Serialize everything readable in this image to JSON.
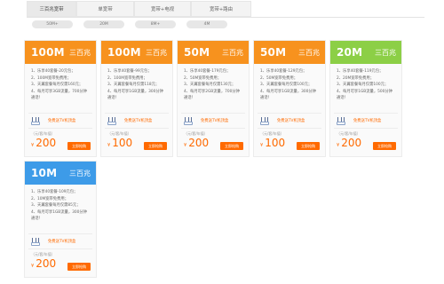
{
  "tabs": [
    "三百兆宽带",
    "单宽带",
    "宽带+电视",
    "宽带+路由"
  ],
  "filters": [
    "50M+",
    "20M",
    "8M+",
    "4M"
  ],
  "colors": {
    "orange": "#f7921e",
    "green": "#8ccf46",
    "blue": "#3d9be8",
    "price": "#ff6a00"
  },
  "cards": [
    {
      "speed": "100M",
      "name": "三百兆",
      "color": "#f7921e",
      "features": [
        "1、乐享40套餐-20元包；",
        "2、100M宽带免费用；",
        "3、天翼套餐每月仅需160元；",
        "4、每月可享3GB流量，700分钟通话！"
      ],
      "gift": "免费送TV机顶盒",
      "unit": "（元/套/年值）",
      "price": "200",
      "currency": "¥",
      "buy": "立即抢购"
    },
    {
      "speed": "100M",
      "name": "三百兆",
      "color": "#f7921e",
      "features": [
        "1、乐享40套餐-99元包；",
        "2、100M宽带免费用；",
        "3、天翼套餐每月仅需118元；",
        "4、每月可享1GB流量，300分钟通话！"
      ],
      "gift": "免费送TV机顶盒",
      "unit": "（元/套/年值）",
      "price": "100",
      "currency": "¥",
      "buy": "立即抢购"
    },
    {
      "speed": "50M",
      "name": "三百兆",
      "color": "#f7921e",
      "features": [
        "1、乐享40套餐-179元包；",
        "2、50M宽带免费用；",
        "3、天翼套餐每月仅需130元；",
        "4、每月可享2GB流量，700分钟通话！"
      ],
      "gift": "免费送TV机顶盒",
      "unit": "（元/套/年值）",
      "price": "200",
      "currency": "¥",
      "buy": "立即抢购"
    },
    {
      "speed": "50M",
      "name": "三百兆",
      "color": "#f7921e",
      "features": [
        "1、乐享40套餐-129元包；",
        "2、50M宽带免费用；",
        "3、天翼套餐每月仅需100元；",
        "4、每月可享1GB流量，300分钟通话！"
      ],
      "gift": "免费送TV机顶盒",
      "unit": "（元/套/年值）",
      "price": "100",
      "currency": "¥",
      "buy": "立即抢购"
    },
    {
      "speed": "20M",
      "name": "三百兆",
      "color": "#8ccf46",
      "features": [
        "1、乐享40套餐-119元包；",
        "2、20M宽带免费用；",
        "3、天翼套餐每月仅需100元；",
        "4、每月可享1GB流量，500分钟通话！"
      ],
      "gift": "免费送TV机顶盒",
      "unit": "（元/套/年值）",
      "price": "200",
      "currency": "¥",
      "buy": "立即抢购"
    },
    {
      "speed": "10M",
      "name": "三百兆",
      "color": "#3d9be8",
      "features": [
        "1、乐享40套餐-109元包；",
        "2、10M宽带免费用；",
        "3、天翼套餐每月仅需85元；",
        "4、每月可享1GB流量，300分钟通话！"
      ],
      "gift": "免费送TV机顶盒",
      "unit": "（元/套/年值）",
      "price": "200",
      "currency": "¥",
      "buy": "立即抢购"
    }
  ]
}
